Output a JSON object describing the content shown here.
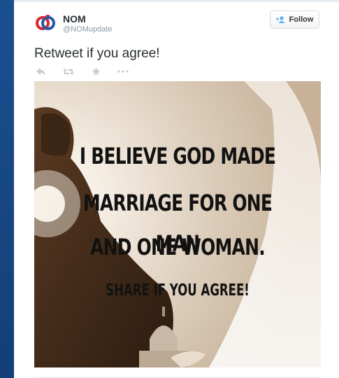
{
  "tweet": {
    "author_name": "NOM",
    "author_handle": "@NOMupdate",
    "follow_label": "Follow",
    "text": "Retweet if you agree!",
    "actions": [
      "reply-icon",
      "retweet-icon",
      "favorite-icon",
      "more-icon"
    ]
  },
  "media": {
    "lines": [
      "I BELIEVE GOD MADE",
      "MARRIAGE FOR ONE MAN",
      "AND ONE WOMAN."
    ],
    "share": "SHARE IF YOU AGREE!"
  },
  "colors": {
    "sidebar": "#1a4f8f",
    "logo_red": "#d8282f",
    "logo_blue": "#2459a8",
    "name": "#292f33",
    "handle": "#8899a6"
  }
}
